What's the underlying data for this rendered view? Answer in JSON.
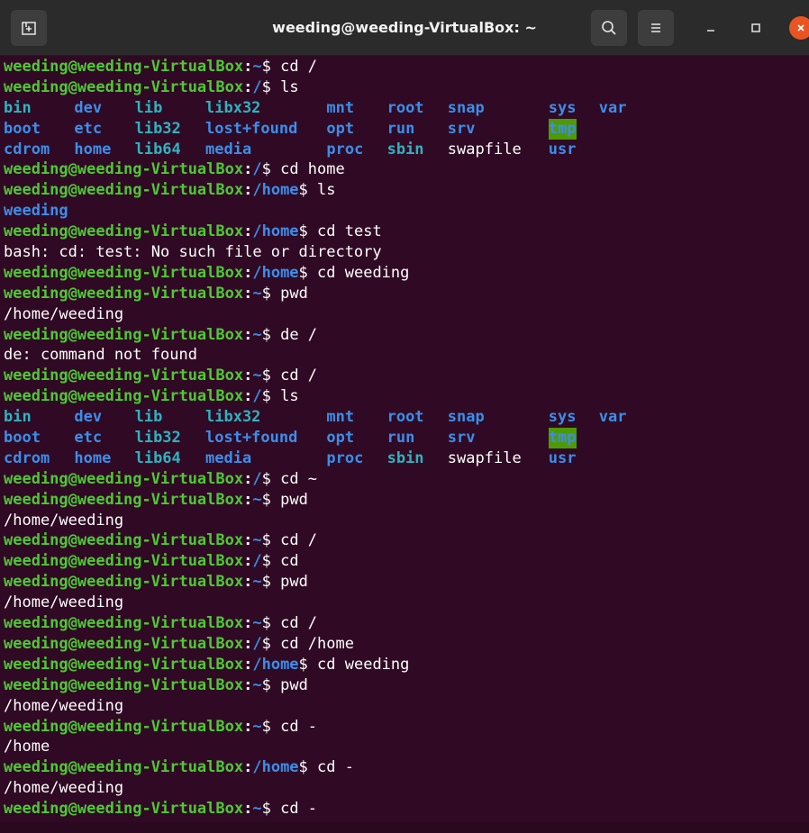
{
  "window": {
    "title": "weeding@weeding-VirtualBox: ~"
  },
  "prompt": {
    "user": "weeding@weeding-VirtualBox",
    "sep": ":",
    "dollar": "$ "
  },
  "lines": [
    {
      "t": "prompt",
      "path": "~",
      "cmd": "cd /"
    },
    {
      "t": "prompt",
      "path": "/",
      "cmd": "ls"
    },
    {
      "t": "ls",
      "items": [
        {
          "text": "bin",
          "kind": "link"
        },
        {
          "text": "dev",
          "kind": "dir"
        },
        {
          "text": "lib",
          "kind": "link"
        },
        {
          "text": "libx32",
          "kind": "link"
        },
        {
          "text": "mnt",
          "kind": "dir"
        },
        {
          "text": "root",
          "kind": "dir"
        },
        {
          "text": "snap",
          "kind": "dir"
        },
        {
          "text": "sys",
          "kind": "dir"
        },
        {
          "text": "var",
          "kind": "dir"
        }
      ]
    },
    {
      "t": "ls",
      "items": [
        {
          "text": "boot",
          "kind": "dir"
        },
        {
          "text": "etc",
          "kind": "dir"
        },
        {
          "text": "lib32",
          "kind": "link"
        },
        {
          "text": "lost+found",
          "kind": "dir"
        },
        {
          "text": "opt",
          "kind": "dir"
        },
        {
          "text": "run",
          "kind": "dir"
        },
        {
          "text": "srv",
          "kind": "dir"
        },
        {
          "text": "tmp",
          "kind": "tmp"
        }
      ]
    },
    {
      "t": "ls",
      "items": [
        {
          "text": "cdrom",
          "kind": "dir"
        },
        {
          "text": "home",
          "kind": "dir"
        },
        {
          "text": "lib64",
          "kind": "link"
        },
        {
          "text": "media",
          "kind": "dir"
        },
        {
          "text": "proc",
          "kind": "dir"
        },
        {
          "text": "sbin",
          "kind": "link"
        },
        {
          "text": "swapfile",
          "kind": "file"
        },
        {
          "text": "usr",
          "kind": "dir"
        }
      ]
    },
    {
      "t": "prompt",
      "path": "/",
      "cmd": "cd home"
    },
    {
      "t": "prompt",
      "path": "/home",
      "cmd": "ls"
    },
    {
      "t": "dirout",
      "text": "weeding"
    },
    {
      "t": "prompt",
      "path": "/home",
      "cmd": "cd test"
    },
    {
      "t": "out",
      "text": "bash: cd: test: No such file or directory"
    },
    {
      "t": "prompt",
      "path": "/home",
      "cmd": "cd weeding"
    },
    {
      "t": "prompt",
      "path": "~",
      "cmd": "pwd"
    },
    {
      "t": "out",
      "text": "/home/weeding"
    },
    {
      "t": "prompt",
      "path": "~",
      "cmd": "de /"
    },
    {
      "t": "out",
      "text": "de: command not found"
    },
    {
      "t": "prompt",
      "path": "~",
      "cmd": "cd /"
    },
    {
      "t": "prompt",
      "path": "/",
      "cmd": "ls"
    },
    {
      "t": "ls",
      "items": [
        {
          "text": "bin",
          "kind": "link"
        },
        {
          "text": "dev",
          "kind": "dir"
        },
        {
          "text": "lib",
          "kind": "link"
        },
        {
          "text": "libx32",
          "kind": "link"
        },
        {
          "text": "mnt",
          "kind": "dir"
        },
        {
          "text": "root",
          "kind": "dir"
        },
        {
          "text": "snap",
          "kind": "dir"
        },
        {
          "text": "sys",
          "kind": "dir"
        },
        {
          "text": "var",
          "kind": "dir"
        }
      ]
    },
    {
      "t": "ls",
      "items": [
        {
          "text": "boot",
          "kind": "dir"
        },
        {
          "text": "etc",
          "kind": "dir"
        },
        {
          "text": "lib32",
          "kind": "link"
        },
        {
          "text": "lost+found",
          "kind": "dir"
        },
        {
          "text": "opt",
          "kind": "dir"
        },
        {
          "text": "run",
          "kind": "dir"
        },
        {
          "text": "srv",
          "kind": "dir"
        },
        {
          "text": "tmp",
          "kind": "tmp"
        }
      ]
    },
    {
      "t": "ls",
      "items": [
        {
          "text": "cdrom",
          "kind": "dir"
        },
        {
          "text": "home",
          "kind": "dir"
        },
        {
          "text": "lib64",
          "kind": "link"
        },
        {
          "text": "media",
          "kind": "dir"
        },
        {
          "text": "proc",
          "kind": "dir"
        },
        {
          "text": "sbin",
          "kind": "link"
        },
        {
          "text": "swapfile",
          "kind": "file"
        },
        {
          "text": "usr",
          "kind": "dir"
        }
      ]
    },
    {
      "t": "prompt",
      "path": "/",
      "cmd": "cd ~"
    },
    {
      "t": "prompt",
      "path": "~",
      "cmd": "pwd"
    },
    {
      "t": "out",
      "text": "/home/weeding"
    },
    {
      "t": "prompt",
      "path": "~",
      "cmd": "cd /"
    },
    {
      "t": "prompt",
      "path": "/",
      "cmd": "cd"
    },
    {
      "t": "prompt",
      "path": "~",
      "cmd": "pwd"
    },
    {
      "t": "out",
      "text": "/home/weeding"
    },
    {
      "t": "prompt",
      "path": "~",
      "cmd": "cd /"
    },
    {
      "t": "prompt",
      "path": "/",
      "cmd": "cd /home"
    },
    {
      "t": "prompt",
      "path": "/home",
      "cmd": "cd weeding"
    },
    {
      "t": "prompt",
      "path": "~",
      "cmd": "pwd"
    },
    {
      "t": "out",
      "text": "/home/weeding"
    },
    {
      "t": "prompt",
      "path": "~",
      "cmd": "cd -"
    },
    {
      "t": "out",
      "text": "/home"
    },
    {
      "t": "prompt",
      "path": "/home",
      "cmd": "cd -"
    },
    {
      "t": "out",
      "text": "/home/weeding"
    },
    {
      "t": "prompt",
      "path": "~",
      "cmd": "cd -"
    }
  ],
  "colors": {
    "background": "#300a24",
    "prompt_user": "#4ec934",
    "prompt_path": "#3b8eea",
    "link": "#2fb3c0",
    "tmp_bg": "#4e9a06",
    "titlebar": "#2b2b2b",
    "close": "#e95420"
  },
  "icons": {
    "new_tab": "new-tab-icon",
    "search": "search-icon",
    "menu": "hamburger-menu-icon",
    "minimize": "minimize-icon",
    "maximize": "maximize-icon",
    "close": "close-icon"
  }
}
